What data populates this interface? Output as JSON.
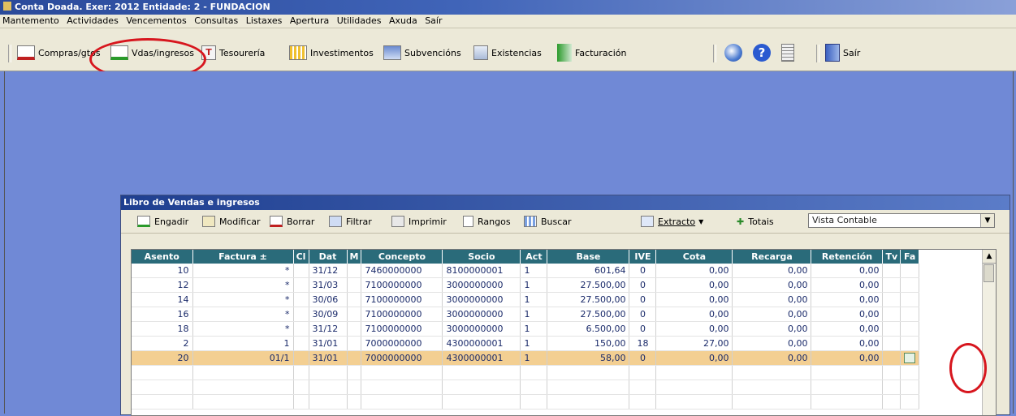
{
  "window": {
    "title": "Conta Doada. Exer: 2012   Entidade: 2 - FUNDACION"
  },
  "menu": [
    "Mantemento",
    "Actividades",
    "Vencementos",
    "Consultas",
    "Listaxes",
    "Apertura",
    "Utilidades",
    "Axuda",
    "Saír"
  ],
  "toolbar": {
    "compras": "Compras/gtos",
    "vdas": "Vdas/ingresos",
    "tesoureria": "Tesourería",
    "investimentos": "Investimentos",
    "subvencions": "Subvencións",
    "existencias": "Existencias",
    "facturacion": "Facturación",
    "sair": "Saír"
  },
  "libro": {
    "title": "Libro de Vendas e ingresos",
    "tools": {
      "engadir": "Engadir",
      "modificar": "Modificar",
      "borrar": "Borrar",
      "filtrar": "Filtrar",
      "imprimir": "Imprimir",
      "rangos": "Rangos",
      "buscar": "Buscar",
      "extracto": "Extracto",
      "totais": "Totais"
    },
    "vista": "Vista Contable",
    "columns": [
      "Asento",
      "Factura ±",
      "Cl",
      "Dat",
      "M",
      "Concepto",
      "Socio",
      "Act",
      "Base",
      "IVE",
      "Cota",
      "Recarga",
      "Retención",
      "Tv",
      "Fa"
    ],
    "rows": [
      {
        "asento": "10",
        "factura": "*",
        "cl": "",
        "dat": "31/12",
        "m": "",
        "concepto": "7460000000",
        "socio": "8100000001",
        "act": "1",
        "base": "601,64",
        "ive": "0",
        "cota": "0,00",
        "recarga": "0,00",
        "retencion": "0,00"
      },
      {
        "asento": "12",
        "factura": "*",
        "cl": "",
        "dat": "31/03",
        "m": "",
        "concepto": "7100000000",
        "socio": "3000000000",
        "act": "1",
        "base": "27.500,00",
        "ive": "0",
        "cota": "0,00",
        "recarga": "0,00",
        "retencion": "0,00"
      },
      {
        "asento": "14",
        "factura": "*",
        "cl": "",
        "dat": "30/06",
        "m": "",
        "concepto": "7100000000",
        "socio": "3000000000",
        "act": "1",
        "base": "27.500,00",
        "ive": "0",
        "cota": "0,00",
        "recarga": "0,00",
        "retencion": "0,00"
      },
      {
        "asento": "16",
        "factura": "*",
        "cl": "",
        "dat": "30/09",
        "m": "",
        "concepto": "7100000000",
        "socio": "3000000000",
        "act": "1",
        "base": "27.500,00",
        "ive": "0",
        "cota": "0,00",
        "recarga": "0,00",
        "retencion": "0,00"
      },
      {
        "asento": "18",
        "factura": "*",
        "cl": "",
        "dat": "31/12",
        "m": "",
        "concepto": "7100000000",
        "socio": "3000000000",
        "act": "1",
        "base": "6.500,00",
        "ive": "0",
        "cota": "0,00",
        "recarga": "0,00",
        "retencion": "0,00"
      },
      {
        "asento": "2",
        "factura": "1",
        "cl": "",
        "dat": "31/01",
        "m": "",
        "concepto": "7000000000",
        "socio": "4300000001",
        "act": "1",
        "base": "150,00",
        "ive": "18",
        "cota": "27,00",
        "recarga": "0,00",
        "retencion": "0,00"
      },
      {
        "asento": "20",
        "factura": "01/1",
        "cl": "",
        "dat": "31/01",
        "m": "",
        "concepto": "7000000000",
        "socio": "4300000001",
        "act": "1",
        "base": "58,00",
        "ive": "0",
        "cota": "0,00",
        "recarga": "0,00",
        "retencion": "0,00"
      }
    ]
  }
}
